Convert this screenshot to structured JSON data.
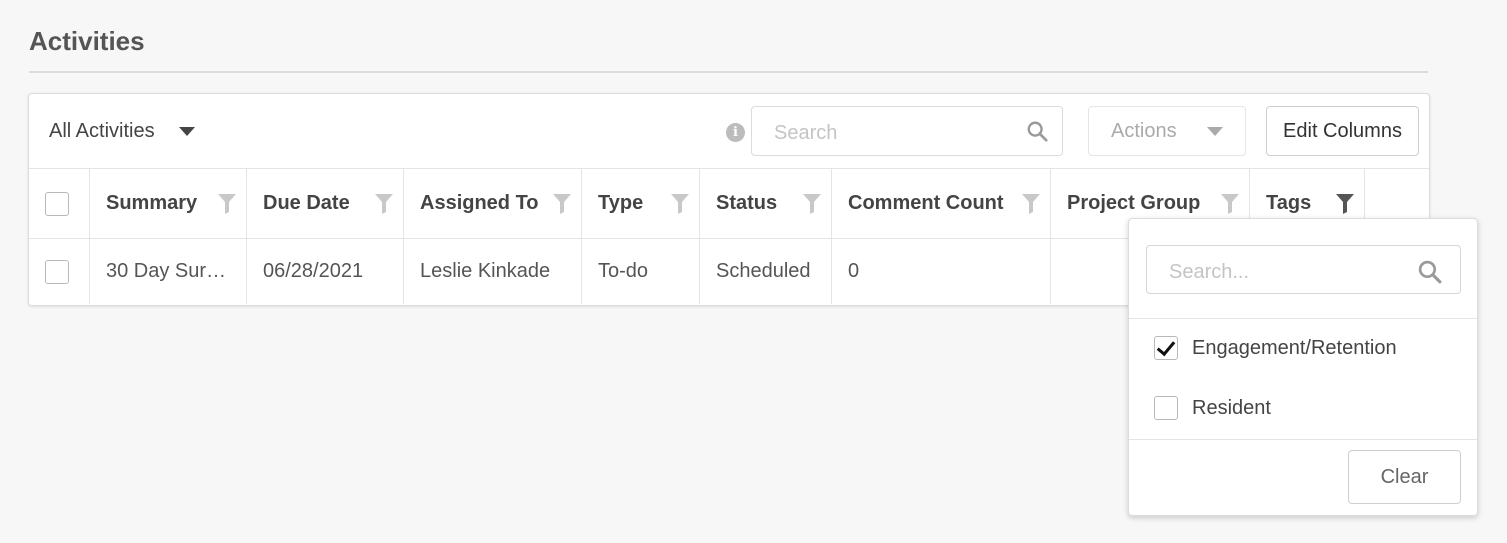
{
  "header": {
    "title": "Activities"
  },
  "toolbar": {
    "view_label": "All Activities",
    "search_placeholder": "Search",
    "actions_label": "Actions",
    "edit_columns_label": "Edit Columns"
  },
  "table": {
    "columns": [
      "Summary",
      "Due Date",
      "Assigned To",
      "Type",
      "Status",
      "Comment Count",
      "Project Group",
      "Tags"
    ],
    "rows": [
      {
        "summary": "30 Day Sur…",
        "due_date": "06/28/2021",
        "assigned_to": "Leslie Kinkade",
        "type": "To-do",
        "status": "Scheduled",
        "comment_count": "0",
        "project_group": "",
        "tags": ""
      }
    ]
  },
  "tag_filter": {
    "search_placeholder": "Search...",
    "options": [
      {
        "label": "Engagement/Retention",
        "checked": true
      },
      {
        "label": "Resident",
        "checked": false
      }
    ],
    "clear_label": "Clear"
  },
  "icons": [
    "chevron-down-icon",
    "info-icon",
    "search-icon",
    "filter-icon",
    "checkmark-icon"
  ],
  "colors": {
    "background": "#f7f7f7",
    "border": "#dcdcdc",
    "filter_icon_inactive": "#c8c8c8",
    "filter_icon_active": "#555555"
  }
}
